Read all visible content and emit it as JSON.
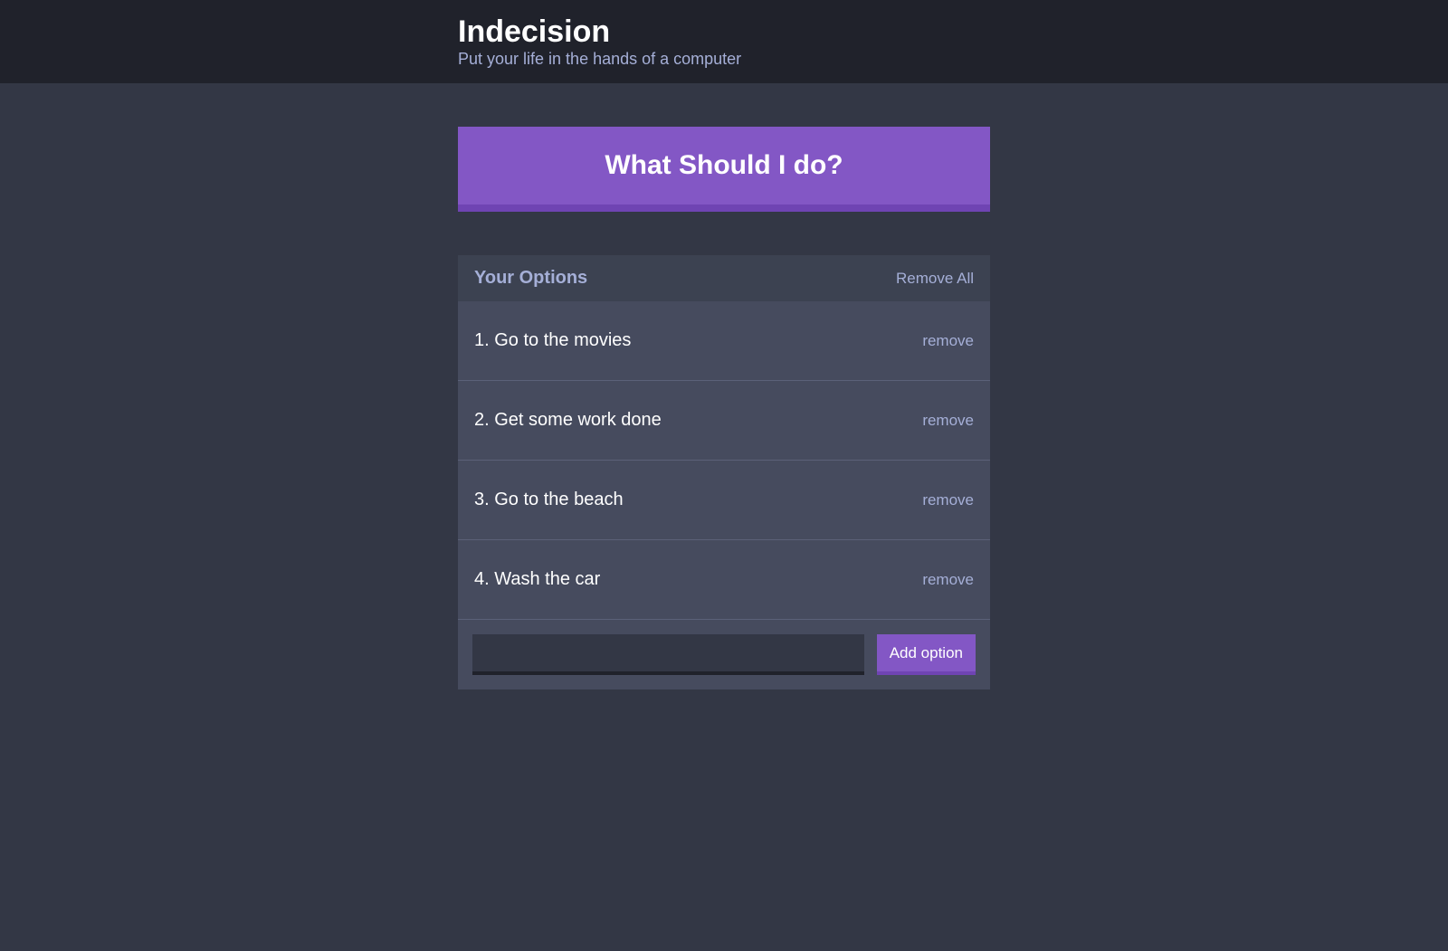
{
  "header": {
    "title": "Indecision",
    "subtitle": "Put your life in the hands of a computer"
  },
  "action_button": {
    "label": "What Should I do?"
  },
  "widget": {
    "title": "Your Options",
    "remove_all_label": "Remove All",
    "remove_label": "remove",
    "options": [
      {
        "number": "1",
        "text": "Go to the movies"
      },
      {
        "number": "2",
        "text": "Get some work done"
      },
      {
        "number": "3",
        "text": "Go to the beach"
      },
      {
        "number": "4",
        "text": "Wash the car"
      }
    ]
  },
  "add_option": {
    "input_value": "",
    "button_label": "Add option"
  }
}
